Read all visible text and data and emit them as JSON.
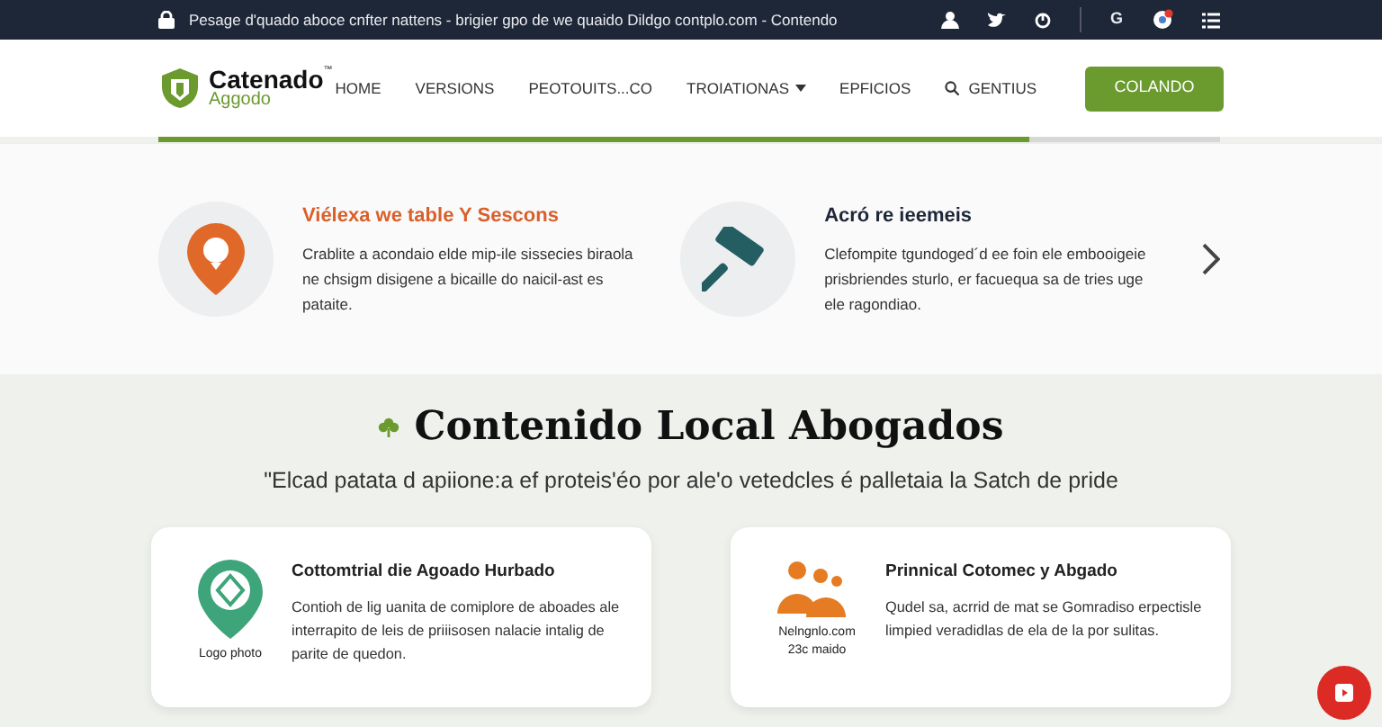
{
  "top_bar": {
    "message": "Pesage d'quado aboce cnfter nattens - brigier gpo de we quaido Dildgo contplo.com - Contendo",
    "social": [
      "G"
    ]
  },
  "brand": {
    "name": "Catenado",
    "tm": "™",
    "subtitle": "Aggodo"
  },
  "nav": [
    {
      "label": "HOME",
      "kind": "link"
    },
    {
      "label": "VERSIONS",
      "kind": "link"
    },
    {
      "label": "PEOTOUITS...CO",
      "kind": "link"
    },
    {
      "label": "TROIATIONAS",
      "kind": "dropdown"
    },
    {
      "label": "EPFICIOS",
      "kind": "link"
    },
    {
      "label": "GENTIUS",
      "kind": "search"
    }
  ],
  "cta": "COLANDO",
  "progress": {
    "level": 0.82
  },
  "features": [
    {
      "title": "Viélexa we table Y Sescons",
      "text": "Crablite a acondaio elde mip-ile sissecies biraola ne chsigm disigene a bicaille do naicil-ast es pataite.",
      "kind": "pin",
      "accent": true
    },
    {
      "title": "Acró re ieemeis",
      "text": "Clefompite tgundoged´d ee foin ele embooigeie prisbriendes sturlo, er facuequa sa de tries uge ele ragondiao.",
      "kind": "gavel",
      "accent": false
    }
  ],
  "section": {
    "title": "Contenido Local Abogados",
    "subtitle": "\"Elcad patata d apiione:a ef proteis'éo por ale'o vetedcles é palletaia la Satch de pride"
  },
  "cards": [
    {
      "kind": "pin",
      "caption": [
        "Logo photo"
      ],
      "title": "Cottomtrial die Agoado Hurbado",
      "text": "Contioh de lig uanita de comiplore de aboades ale interrapito de leis de priiisosen nalacie intalig de parite de quedon."
    },
    {
      "kind": "people",
      "caption": [
        "Nelngnlo.com",
        "23c maido"
      ],
      "title": "Prinnical Cotomec y Abgado",
      "text": "Qudel sa, acrrid de mat se Gomradiso erpectisle limpied veradidlas de ela de la por sulitas."
    }
  ]
}
